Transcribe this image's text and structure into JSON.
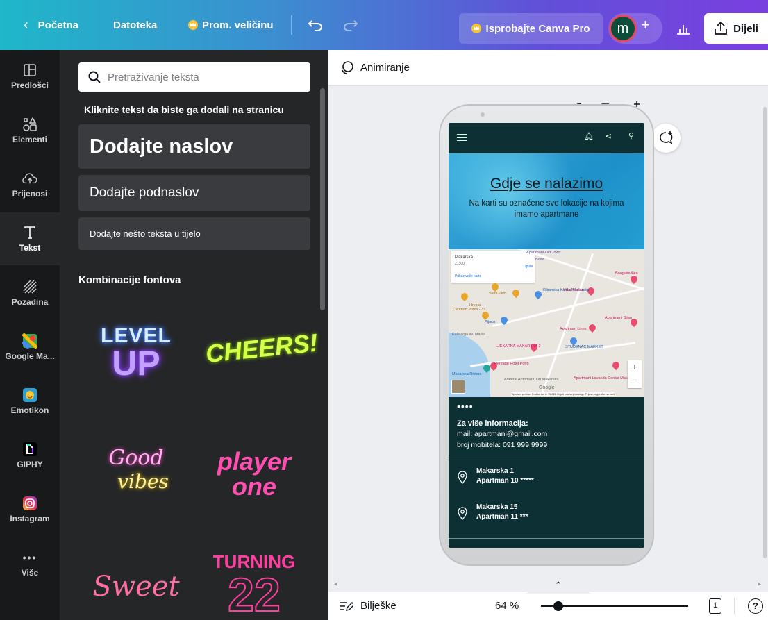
{
  "topbar": {
    "home": "Početna",
    "file": "Datoteka",
    "resize": "Prom. veličinu",
    "try_pro": "Isprobajte Canva Pro",
    "avatar_letter": "m",
    "share": "Dijeli",
    "colors": {
      "accent": "#7d2ae8",
      "crown": "#f7c434"
    }
  },
  "rail": {
    "items": [
      {
        "label": "Predlošci",
        "icon": "layout-icon"
      },
      {
        "label": "Elementi",
        "icon": "shapes-icon"
      },
      {
        "label": "Prijenosi",
        "icon": "cloud-upload-icon"
      },
      {
        "label": "Tekst",
        "icon": "text-icon"
      },
      {
        "label": "Pozadina",
        "icon": "hatch-icon"
      },
      {
        "label": "Google Ma...",
        "icon": "google-maps-icon"
      },
      {
        "label": "Emotikon",
        "icon": "emoji-icon"
      },
      {
        "label": "GIPHY",
        "icon": "giphy-icon"
      },
      {
        "label": "Instagram",
        "icon": "instagram-icon"
      },
      {
        "label": "Više",
        "icon": "more-icon"
      }
    ]
  },
  "panel": {
    "search_placeholder": "Pretraživanje teksta",
    "hint": "Kliknite tekst da biste ga dodali na stranicu",
    "heading": "Dodajte naslov",
    "subheading": "Dodajte podnaslov",
    "body": "Dodajte nešto teksta u tijelo",
    "font_combos_title": "Kombinacije fontova",
    "combos": [
      {
        "lines": [
          "LEVEL",
          "UP"
        ]
      },
      {
        "lines": [
          "CHEERS!"
        ]
      },
      {
        "lines": [
          "Good",
          "vibes"
        ]
      },
      {
        "lines": [
          "player",
          "one"
        ]
      },
      {
        "lines": [
          "Sweet"
        ]
      },
      {
        "lines": [
          "TURNING",
          "22"
        ]
      }
    ]
  },
  "toolbar": {
    "animate": "Animiranje"
  },
  "design": {
    "hero_title": "Gdje se nalazimo",
    "hero_subtitle": "Na karti su označene sve lokacije na kojima imamo apartmane",
    "map": {
      "card_title": "Makarska",
      "card_sub": "21300",
      "card_link": "Prikaz veće karte",
      "card_dir": "Upute",
      "labels": [
        "Apartmani Old Town",
        "Bose",
        "Bougainvillea",
        "Ribarnica Kantar Makarska",
        "Villa Madlen",
        "Sveti Đivo",
        "Hrvoja",
        "Centrum Pizza - 33",
        "Pijaca",
        "Apartmani Bijan",
        "Apartman Lines",
        "Kalelarga sv. Marka",
        "LJEKARNA MAKARSKA 2",
        "STUDENAC MARKET",
        "Makarska Riviera",
        "Heritage Hotel Porin",
        "Admiral Automat Club Makarska",
        "Apartmani Lavanda Centar Makarska",
        "Google"
      ],
      "footer": "Tipkovni prečaci   Podaci karte ©2022   Uvjeti pružanja usluge   Prijavi pogrešku na karti"
    },
    "dots": "••••",
    "info_title": "Za više informacija:",
    "info_mail": "mail: apartmani@gmail.com",
    "info_phone": "broj mobitela: 091 999 9999",
    "locations": [
      {
        "line1": "Makarska 1",
        "line2": "Apartman 10 *****"
      },
      {
        "line1": "Makarska 15",
        "line2": "Apartman 11 ***"
      }
    ]
  },
  "bottombar": {
    "notes": "Bilješke",
    "zoom": "64 %",
    "page": "1",
    "help": "?"
  }
}
